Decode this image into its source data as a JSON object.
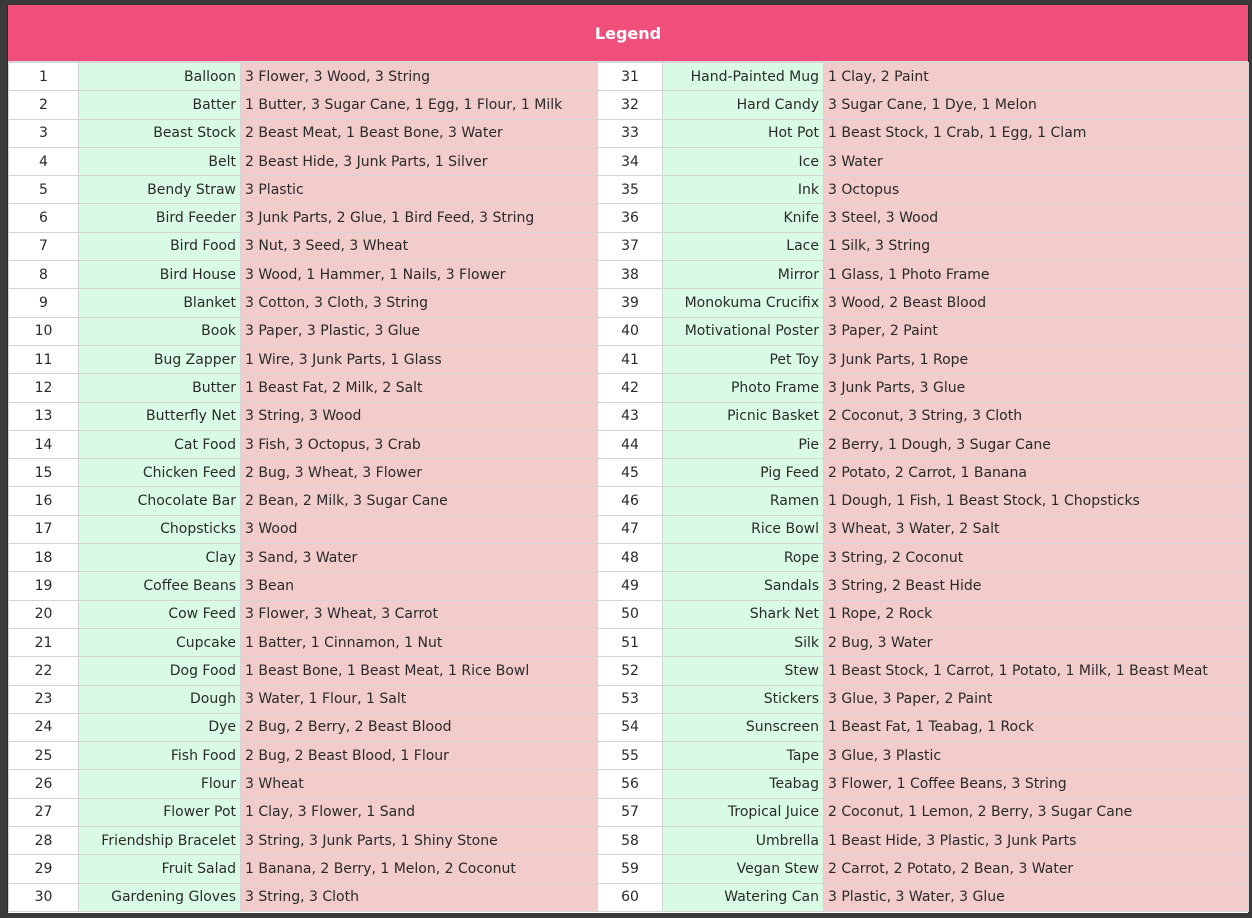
{
  "legend": {
    "title": "Legend"
  },
  "rows": [
    {
      "left": {
        "num": "1",
        "item": "Balloon",
        "ingredients": "3 Flower, 3 Wood, 3 String"
      },
      "right": {
        "num": "31",
        "item": "Hand-Painted Mug",
        "ingredients": "1 Clay, 2 Paint"
      }
    },
    {
      "left": {
        "num": "2",
        "item": "Batter",
        "ingredients": "1 Butter, 3 Sugar Cane, 1 Egg, 1 Flour, 1 Milk"
      },
      "right": {
        "num": "32",
        "item": "Hard Candy",
        "ingredients": "3 Sugar Cane, 1 Dye, 1 Melon"
      }
    },
    {
      "left": {
        "num": "3",
        "item": "Beast Stock",
        "ingredients": "2 Beast Meat, 1 Beast Bone, 3 Water"
      },
      "right": {
        "num": "33",
        "item": "Hot Pot",
        "ingredients": "1 Beast Stock, 1 Crab, 1 Egg, 1 Clam"
      }
    },
    {
      "left": {
        "num": "4",
        "item": "Belt",
        "ingredients": "2 Beast Hide, 3 Junk Parts, 1 Silver"
      },
      "right": {
        "num": "34",
        "item": "Ice",
        "ingredients": "3 Water"
      }
    },
    {
      "left": {
        "num": "5",
        "item": "Bendy Straw",
        "ingredients": "3 Plastic"
      },
      "right": {
        "num": "35",
        "item": "Ink",
        "ingredients": "3 Octopus"
      }
    },
    {
      "left": {
        "num": "6",
        "item": "Bird Feeder",
        "ingredients": "3 Junk Parts, 2 Glue, 1 Bird Feed, 3 String"
      },
      "right": {
        "num": "36",
        "item": "Knife",
        "ingredients": "3 Steel, 3 Wood"
      }
    },
    {
      "left": {
        "num": "7",
        "item": "Bird Food",
        "ingredients": "3 Nut, 3 Seed, 3 Wheat"
      },
      "right": {
        "num": "37",
        "item": "Lace",
        "ingredients": "1 Silk, 3 String"
      }
    },
    {
      "left": {
        "num": "8",
        "item": "Bird House",
        "ingredients": "3 Wood, 1 Hammer, 1 Nails, 3 Flower"
      },
      "right": {
        "num": "38",
        "item": "Mirror",
        "ingredients": "1 Glass, 1 Photo Frame"
      }
    },
    {
      "left": {
        "num": "9",
        "item": "Blanket",
        "ingredients": "3 Cotton, 3 Cloth, 3 String"
      },
      "right": {
        "num": "39",
        "item": "Monokuma Crucifix",
        "ingredients": "3 Wood, 2 Beast Blood"
      }
    },
    {
      "left": {
        "num": "10",
        "item": "Book",
        "ingredients": "3 Paper, 3 Plastic, 3 Glue"
      },
      "right": {
        "num": "40",
        "item": "Motivational Poster",
        "ingredients": "3 Paper, 2 Paint"
      }
    },
    {
      "left": {
        "num": "11",
        "item": "Bug Zapper",
        "ingredients": "1 Wire, 3 Junk Parts, 1 Glass"
      },
      "right": {
        "num": "41",
        "item": "Pet Toy",
        "ingredients": "3 Junk Parts, 1 Rope"
      }
    },
    {
      "left": {
        "num": "12",
        "item": "Butter",
        "ingredients": "1 Beast Fat, 2 Milk, 2 Salt"
      },
      "right": {
        "num": "42",
        "item": "Photo Frame",
        "ingredients": "3 Junk Parts, 3 Glue"
      }
    },
    {
      "left": {
        "num": "13",
        "item": "Butterfly Net",
        "ingredients": "3 String, 3 Wood"
      },
      "right": {
        "num": "43",
        "item": "Picnic Basket",
        "ingredients": "2 Coconut, 3 String, 3 Cloth"
      }
    },
    {
      "left": {
        "num": "14",
        "item": "Cat Food",
        "ingredients": "3 Fish, 3 Octopus, 3 Crab"
      },
      "right": {
        "num": "44",
        "item": "Pie",
        "ingredients": "2 Berry, 1 Dough, 3 Sugar Cane"
      }
    },
    {
      "left": {
        "num": "15",
        "item": "Chicken Feed",
        "ingredients": "2 Bug, 3 Wheat, 3 Flower"
      },
      "right": {
        "num": "45",
        "item": "Pig Feed",
        "ingredients": "2 Potato, 2 Carrot, 1 Banana"
      }
    },
    {
      "left": {
        "num": "16",
        "item": "Chocolate Bar",
        "ingredients": "2 Bean, 2 Milk, 3 Sugar Cane"
      },
      "right": {
        "num": "46",
        "item": "Ramen",
        "ingredients": "1 Dough, 1 Fish, 1 Beast Stock, 1 Chopsticks"
      }
    },
    {
      "left": {
        "num": "17",
        "item": "Chopsticks",
        "ingredients": "3 Wood"
      },
      "right": {
        "num": "47",
        "item": "Rice Bowl",
        "ingredients": "3 Wheat, 3 Water, 2 Salt"
      }
    },
    {
      "left": {
        "num": "18",
        "item": "Clay",
        "ingredients": "3 Sand, 3 Water"
      },
      "right": {
        "num": "48",
        "item": "Rope",
        "ingredients": "3 String, 2 Coconut"
      }
    },
    {
      "left": {
        "num": "19",
        "item": "Coffee Beans",
        "ingredients": "3 Bean"
      },
      "right": {
        "num": "49",
        "item": "Sandals",
        "ingredients": "3 String, 2 Beast Hide"
      }
    },
    {
      "left": {
        "num": "20",
        "item": "Cow Feed",
        "ingredients": "3 Flower, 3 Wheat, 3 Carrot"
      },
      "right": {
        "num": "50",
        "item": "Shark Net",
        "ingredients": "1 Rope, 2 Rock"
      }
    },
    {
      "left": {
        "num": "21",
        "item": "Cupcake",
        "ingredients": "1 Batter, 1 Cinnamon, 1 Nut"
      },
      "right": {
        "num": "51",
        "item": "Silk",
        "ingredients": "2 Bug, 3 Water"
      }
    },
    {
      "left": {
        "num": "22",
        "item": "Dog Food",
        "ingredients": "1 Beast Bone, 1 Beast Meat, 1 Rice Bowl"
      },
      "right": {
        "num": "52",
        "item": "Stew",
        "ingredients": "1 Beast Stock, 1 Carrot, 1 Potato, 1 Milk, 1 Beast Meat"
      }
    },
    {
      "left": {
        "num": "23",
        "item": "Dough",
        "ingredients": "3 Water, 1 Flour, 1 Salt"
      },
      "right": {
        "num": "53",
        "item": "Stickers",
        "ingredients": "3 Glue, 3 Paper, 2 Paint"
      }
    },
    {
      "left": {
        "num": "24",
        "item": "Dye",
        "ingredients": "2 Bug, 2 Berry, 2 Beast Blood"
      },
      "right": {
        "num": "54",
        "item": "Sunscreen",
        "ingredients": "1 Beast Fat, 1 Teabag, 1 Rock"
      }
    },
    {
      "left": {
        "num": "25",
        "item": "Fish Food",
        "ingredients": "2 Bug, 2 Beast Blood, 1 Flour"
      },
      "right": {
        "num": "55",
        "item": "Tape",
        "ingredients": "3 Glue, 3 Plastic"
      }
    },
    {
      "left": {
        "num": "26",
        "item": "Flour",
        "ingredients": "3 Wheat"
      },
      "right": {
        "num": "56",
        "item": "Teabag",
        "ingredients": "3 Flower, 1 Coffee Beans, 3 String"
      }
    },
    {
      "left": {
        "num": "27",
        "item": "Flower Pot",
        "ingredients": "1 Clay, 3 Flower, 1 Sand"
      },
      "right": {
        "num": "57",
        "item": "Tropical Juice",
        "ingredients": "2 Coconut, 1 Lemon, 2 Berry, 3 Sugar Cane"
      }
    },
    {
      "left": {
        "num": "28",
        "item": "Friendship Bracelet",
        "ingredients": "3 String, 3 Junk Parts, 1 Shiny Stone"
      },
      "right": {
        "num": "58",
        "item": "Umbrella",
        "ingredients": "1 Beast Hide, 3 Plastic, 3 Junk Parts"
      }
    },
    {
      "left": {
        "num": "29",
        "item": "Fruit Salad",
        "ingredients": "1 Banana, 2 Berry, 1 Melon, 2 Coconut"
      },
      "right": {
        "num": "59",
        "item": "Vegan Stew",
        "ingredients": "2 Carrot, 2 Potato, 2 Bean, 3 Water"
      }
    },
    {
      "left": {
        "num": "30",
        "item": "Gardening Gloves",
        "ingredients": "3 String, 3 Cloth"
      },
      "right": {
        "num": "60",
        "item": "Watering Can",
        "ingredients": "3 Plastic, 3 Water, 3 Glue"
      }
    }
  ]
}
